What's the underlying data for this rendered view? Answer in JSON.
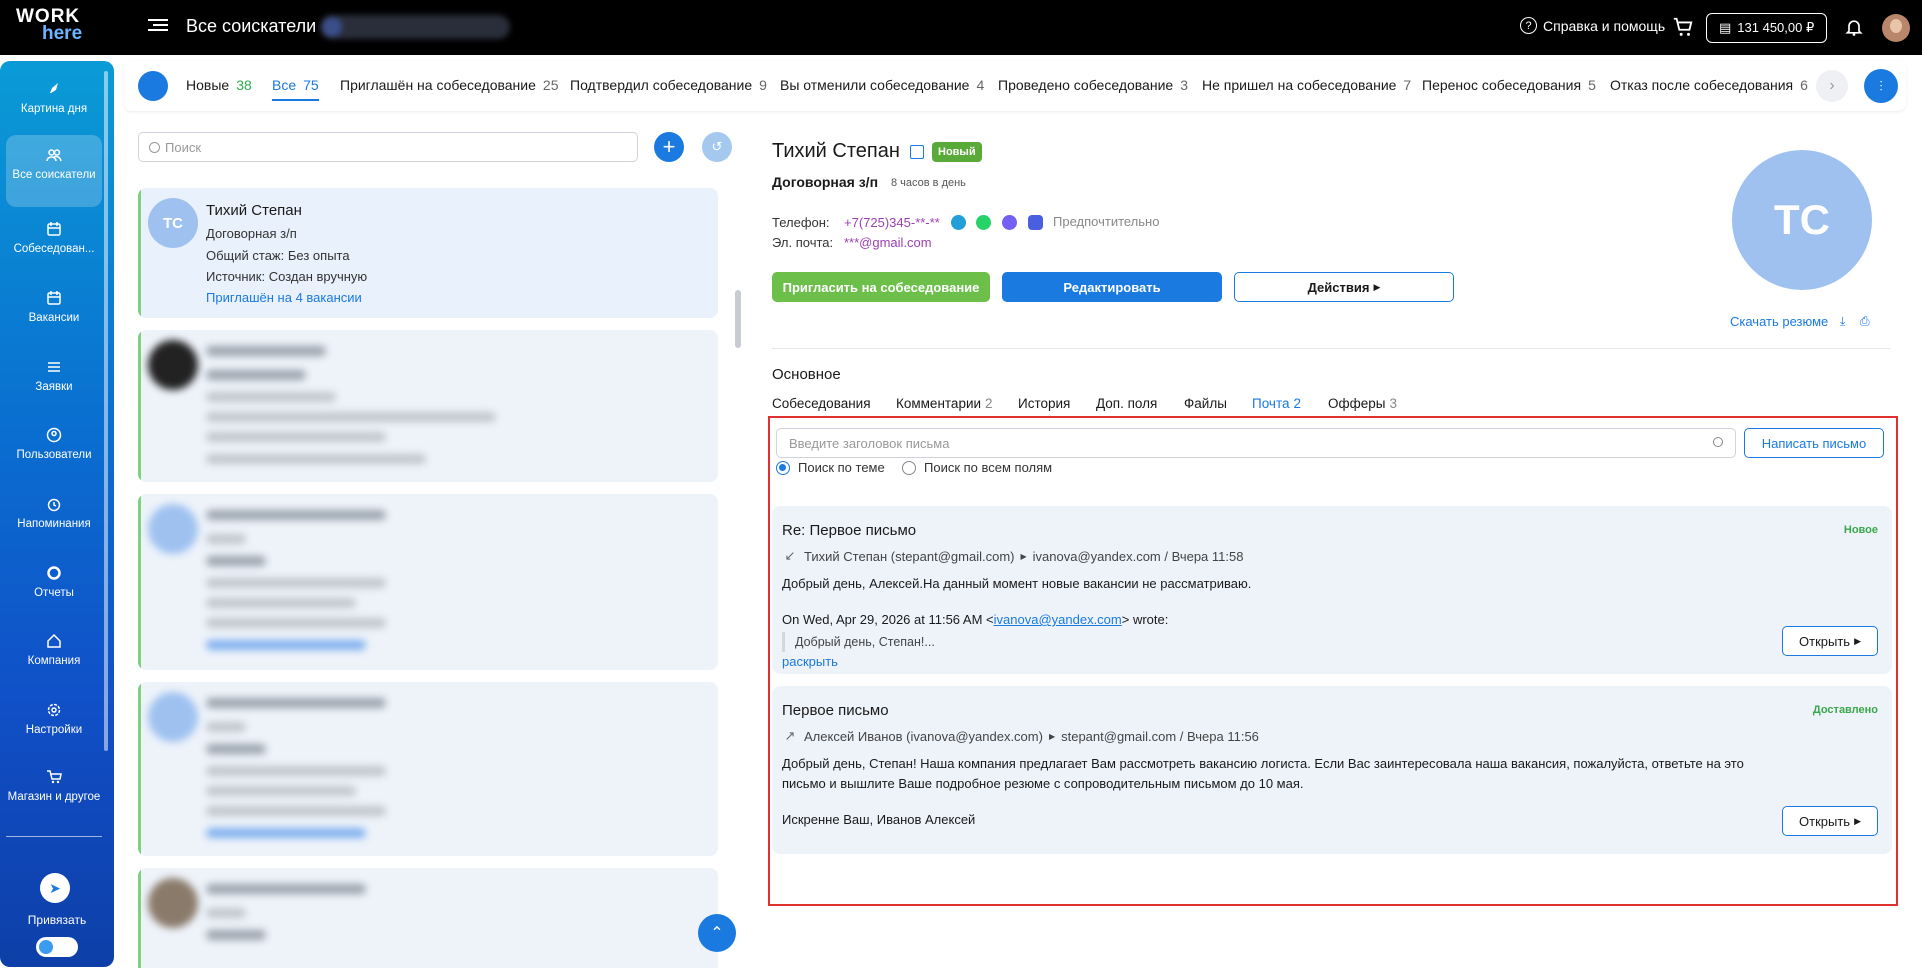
{
  "topbar": {
    "logo_line1": "WORK",
    "logo_line2": "here",
    "title": "Все соискатели",
    "help": "Справка и помощь",
    "balance": "131 450,00 ₽"
  },
  "sidebar": {
    "items": [
      {
        "label": "Картина дня",
        "icon": "rocket-icon"
      },
      {
        "label": "Все соискатели",
        "icon": "users-icon"
      },
      {
        "label": "Собеседован...",
        "icon": "calendar-icon"
      },
      {
        "label": "Вакансии",
        "icon": "calendar-icon"
      },
      {
        "label": "Заявки",
        "icon": "list-icon"
      },
      {
        "label": "Пользователи",
        "icon": "user-circle-icon"
      },
      {
        "label": "Напоминания",
        "icon": "alarm-icon"
      },
      {
        "label": "Отчеты",
        "icon": "chart-ring-icon"
      },
      {
        "label": "Компания",
        "icon": "home-icon"
      },
      {
        "label": "Настройки",
        "icon": "gear-icon"
      },
      {
        "label": "Магазин и другое",
        "icon": "shop-icon"
      }
    ],
    "telegram_label": "Привязать",
    "active_color": "#1a7ae0"
  },
  "tabs": [
    {
      "label": "Новые",
      "count": "38"
    },
    {
      "label": "Все",
      "count": "75"
    },
    {
      "label": "Приглашён на собеседование",
      "count": "25"
    },
    {
      "label": "Подтвердил собеседование",
      "count": "9"
    },
    {
      "label": "Вы отменили собеседование",
      "count": "4"
    },
    {
      "label": "Проведено собеседование",
      "count": "3"
    },
    {
      "label": "Не пришел на собеседование",
      "count": "7"
    },
    {
      "label": "Перенос собеседования",
      "count": "5"
    },
    {
      "label": "Отказ после собеседования",
      "count": "6"
    }
  ],
  "list": {
    "search_placeholder": "Поиск",
    "selected": {
      "initials": "ТС",
      "name": "Тихий Степан",
      "salary": "Договорная з/п",
      "exp_label": "Общий стаж:",
      "exp_value": "Без опыта",
      "source_label": "Источник:",
      "source_value": "Создан вручную",
      "invited": "Приглашён на 4 вакансии"
    }
  },
  "candidate": {
    "name": "Тихий Степан",
    "badge": "Новый",
    "salary": "Договорная з/п",
    "hours": "8 часов в день",
    "phone_label": "Телефон:",
    "phone": "+7(725)345-**-**",
    "preferred": "Предпочтительно",
    "email_label": "Эл. почта:",
    "email": "***@gmail.com",
    "btn_invite": "Пригласить на собеседование",
    "btn_edit": "Редактировать",
    "btn_actions": "Действия",
    "initials": "ТС",
    "download": "Скачать резюме",
    "section": "Основное",
    "dtabs": [
      {
        "label": "Собеседования",
        "count": ""
      },
      {
        "label": "Комментарии",
        "count": "2"
      },
      {
        "label": "История",
        "count": ""
      },
      {
        "label": "Доп. поля",
        "count": ""
      },
      {
        "label": "Файлы",
        "count": ""
      },
      {
        "label": "Почта",
        "count": "2"
      },
      {
        "label": "Офферы",
        "count": "3"
      }
    ]
  },
  "mail": {
    "search_placeholder": "Введите заголовок письма",
    "write": "Написать письмо",
    "radio_subject": "Поиск по теме",
    "radio_all": "Поиск по всем полям",
    "messages": [
      {
        "subject": "Re: Первое письмо",
        "status": "Новое",
        "from": "Тихий Степан (stepant@gmail.com)",
        "to": "ivanova@yandex.com / Вчера 11:58",
        "body": "Добрый день, Алексей.На данный момент новые вакансии не рассматриваю.",
        "quote_head_pre": "On Wed, Apr 29, 2026 at 11:56 AM <",
        "quote_head_link": "ivanova@yandex.com",
        "quote_head_post": "> wrote:",
        "quote": "Добрый день, Степан!...",
        "expand": "раскрыть",
        "open": "Открыть"
      },
      {
        "subject": "Первое письмо",
        "status": "Доставлено",
        "from": "Алексей Иванов (ivanova@yandex.com)",
        "to": "stepant@gmail.com / Вчера 11:56",
        "body_line1": "Добрый день, Степан! Наша компания предлагает Вам рассмотреть вакансию логиста. Если Вас заинтересовала наша вакансия, пожалуйста, ответьте на это",
        "body_line2": "письмо и вышлите Ваше подробное резюме с сопроводительным письмом до 10 мая.",
        "signature": "Искренне Ваш, Иванов Алексей",
        "open": "Открыть"
      }
    ]
  }
}
